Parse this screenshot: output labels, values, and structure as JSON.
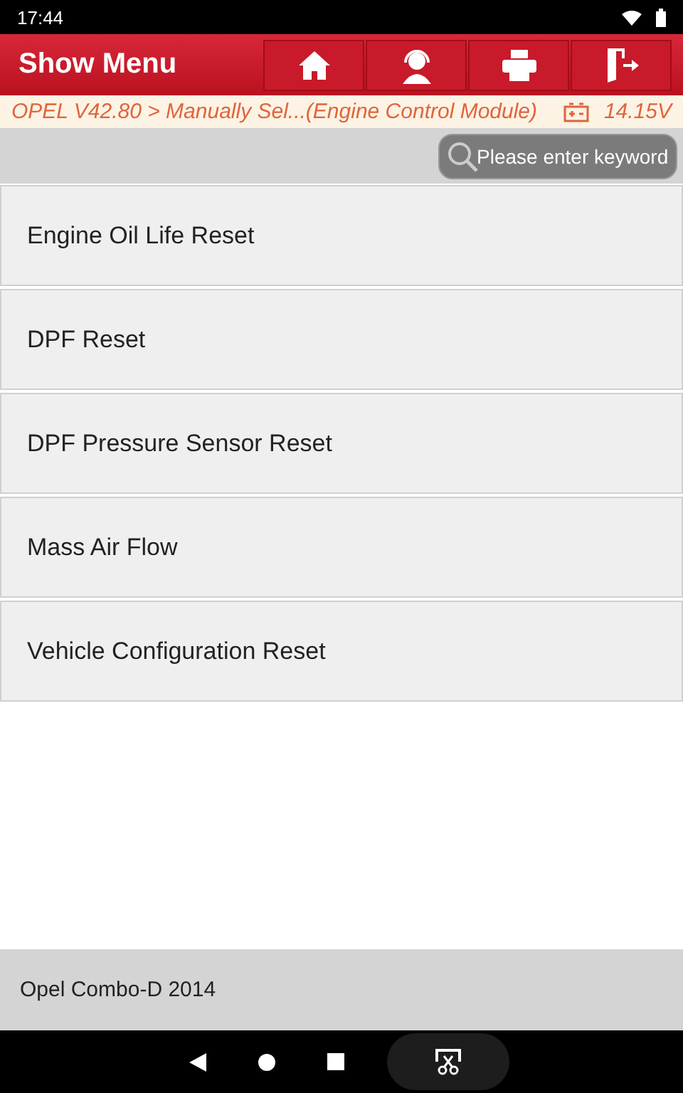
{
  "status_bar": {
    "time": "17:44"
  },
  "header": {
    "title": "Show Menu"
  },
  "breadcrumb": {
    "path": "OPEL V42.80 > Manually Sel...(Engine Control Module)",
    "voltage": "14.15V"
  },
  "search": {
    "placeholder": "Please enter keyword"
  },
  "menu_items": [
    {
      "label": "Engine Oil Life Reset"
    },
    {
      "label": "DPF Reset"
    },
    {
      "label": "DPF Pressure Sensor Reset"
    },
    {
      "label": "Mass Air Flow"
    },
    {
      "label": "Vehicle Configuration Reset"
    }
  ],
  "footer": {
    "vehicle": "Opel Combo-D 2014"
  }
}
